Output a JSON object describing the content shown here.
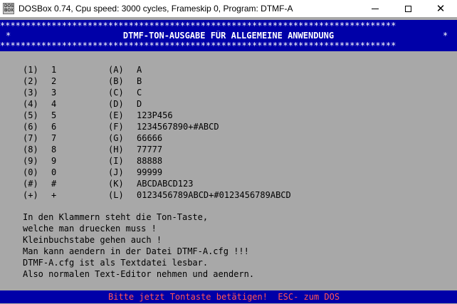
{
  "window": {
    "title": "DOSBox 0.74, Cpu speed:     3000 cycles, Frameskip  0, Program:    DTMF-A",
    "icon_label": "DOS BOX",
    "icons": {
      "app": "dosbox-icon",
      "minimize": "minimize-icon",
      "maximize": "maximize-icon",
      "close": "close-icon"
    },
    "close_glyph": "✕"
  },
  "header": {
    "star_line": "*****************************************************************************",
    "side_star": "*",
    "title": "DTMF-TON-AUSGABE FÜR ALLGEMEINE ANWENDUNG"
  },
  "keys": [
    {
      "key": "(1)",
      "val": "1",
      "key2": "(A)",
      "val2": "A"
    },
    {
      "key": "(2)",
      "val": "2",
      "key2": "(B)",
      "val2": "B"
    },
    {
      "key": "(3)",
      "val": "3",
      "key2": "(C)",
      "val2": "C"
    },
    {
      "key": "(4)",
      "val": "4",
      "key2": "(D)",
      "val2": "D"
    },
    {
      "key": "(5)",
      "val": "5",
      "key2": "(E)",
      "val2": "123P456"
    },
    {
      "key": "(6)",
      "val": "6",
      "key2": "(F)",
      "val2": "1234567890+#ABCD"
    },
    {
      "key": "(7)",
      "val": "7",
      "key2": "(G)",
      "val2": "66666"
    },
    {
      "key": "(8)",
      "val": "8",
      "key2": "(H)",
      "val2": "77777"
    },
    {
      "key": "(9)",
      "val": "9",
      "key2": "(I)",
      "val2": "88888"
    },
    {
      "key": "(0)",
      "val": "0",
      "key2": "(J)",
      "val2": "99999"
    },
    {
      "key": "(#)",
      "val": "#",
      "key2": "(K)",
      "val2": "ABCDABCD123"
    },
    {
      "key": "(+)",
      "val": "+",
      "key2": "(L)",
      "val2": "0123456789ABCD+#0123456789ABCD"
    }
  ],
  "info": [
    "In den Klammern steht die Ton-Taste,",
    "welche man druecken muss !",
    "Kleinbuchstabe gehen auch !",
    "Man kann aendern in der Datei DTMF-A.cfg !!!",
    "DTMF-A.cfg ist als Textdatei lesbar.",
    "Also normalen Text-Editor nehmen und aendern."
  ],
  "status": "Bitte jetzt Tontaste betätigen!  ESC- zum DOS",
  "colors": {
    "dos_blue": "#0000a8",
    "dos_gray": "#a8a8a8",
    "status_text": "#ff5555",
    "text": "#000000",
    "header_text": "#ffffff"
  }
}
